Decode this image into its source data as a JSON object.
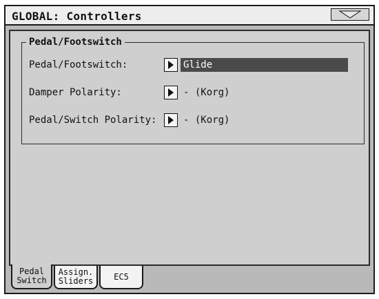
{
  "window": {
    "title": "GLOBAL: Controllers"
  },
  "menu_button": {
    "icon": "triangle-down-icon"
  },
  "group": {
    "title": "Pedal/Footswitch",
    "rows": [
      {
        "label": "Pedal/Footswitch:",
        "value": "Glide",
        "selected": true
      },
      {
        "label": "Damper Polarity:",
        "value": "- (Korg)",
        "selected": false
      },
      {
        "label": "Pedal/Switch Polarity:",
        "value": "- (Korg)",
        "selected": false
      }
    ]
  },
  "tabs": [
    {
      "line1": "Pedal",
      "line2": "Switch",
      "active": true
    },
    {
      "line1": "Assign.",
      "line2": "Sliders",
      "active": false
    },
    {
      "line1": "EC5",
      "line2": "",
      "active": false
    }
  ],
  "colors": {
    "screen_bg": "#b9b9b9",
    "panel_bg": "#cfcfcf",
    "selection": "#4a4a4a"
  }
}
